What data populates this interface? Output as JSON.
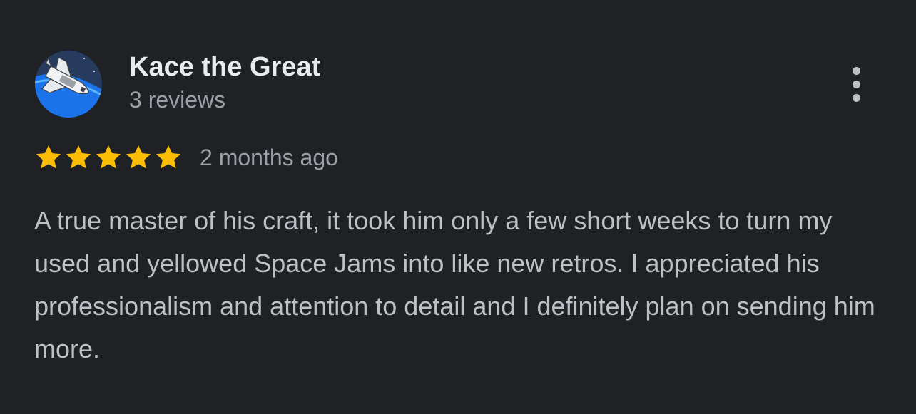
{
  "review": {
    "author_name": "Kace the Great",
    "review_count": "3 reviews",
    "rating": 5,
    "rating_max": 5,
    "date": "2 months ago",
    "text": "A true master of his craft, it took him only a few short weeks to turn my used and yellowed Space Jams into like new retros. I appreciated his professionalism and attention to detail and I definitely plan on sending him more."
  },
  "icons": {
    "avatar": "space-shuttle-avatar",
    "star": "star-icon",
    "menu": "more-vertical-icon"
  },
  "colors": {
    "background": "#202124",
    "star": "#fbbc04",
    "name": "#e8eaed",
    "secondary_text": "#9aa0a6",
    "body_text": "#bdc1c6",
    "avatar_blue": "#1a73e8"
  }
}
